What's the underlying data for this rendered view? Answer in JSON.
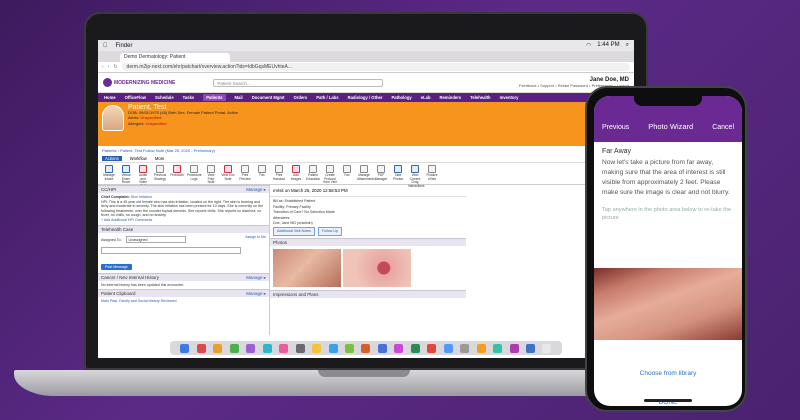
{
  "mac": {
    "app": "Finder",
    "clock": "1:44 PM"
  },
  "browser": {
    "tab": "Demo Dermatology: Patient",
    "url": "derm.m2ip-next.com/ehr/patchart/overview.action?ids=IdbGqsMEUvhteA..."
  },
  "app": {
    "logo": "MODERNIZING MEDICINE",
    "search_placeholder": "Patient Search...",
    "user_name": "Jane Doe, MD",
    "user_links": "Feedback • Support • Retain Password • Preferences • Logout",
    "nav": [
      "Home",
      "OfficeFlow",
      "Schedule",
      "Tasks",
      "Patients",
      "Mail",
      "Document Mgmt",
      "Orders",
      "Path / Labs",
      "Radiology / Other",
      "Pathology",
      "eLab",
      "Reminders",
      "Telehealth",
      "Inventory"
    ],
    "nav_active": "Patients"
  },
  "patient": {
    "name": "Patient, Test",
    "dob_line": "DOB: 09/01/1975 (45)   Birth Sex: Female   Patient Portal: Active",
    "alerts_label": "Alerts:",
    "alerts_value": "Unspecified",
    "allergies_label": "Allergies:",
    "allergies_value": "Unspecified",
    "buttons": [
      "Call Back",
      "",
      ""
    ],
    "breadcrumb": "Patients › Patient, Test Follow Note (Mar 25, 2020 - Preliminary)"
  },
  "tool_tabs": [
    "Actions",
    "Workflow",
    "More"
  ],
  "tools": [
    {
      "label": "Manage Intake",
      "tone": "b"
    },
    {
      "label": "Virtual Exam Room",
      "tone": "b"
    },
    {
      "label": "Audio and Video Call",
      "tone": "r"
    },
    {
      "label": "Previous Strategy",
      "tone": ""
    },
    {
      "label": "Protocols",
      "tone": "r"
    },
    {
      "label": "Procedure Logs",
      "tone": ""
    },
    {
      "label": "View Prior Note",
      "tone": ""
    },
    {
      "label": "View Enc Note",
      "tone": "r"
    },
    {
      "label": "Print Preview",
      "tone": ""
    },
    {
      "label": "Fax",
      "tone": ""
    },
    {
      "label": "Print Handout",
      "tone": ""
    },
    {
      "label": "Add Images",
      "tone": "r"
    },
    {
      "label": "Patient Education",
      "tone": ""
    },
    {
      "label": "Create Protocol from Visit",
      "tone": ""
    },
    {
      "label": "Fax",
      "tone": ""
    },
    {
      "label": "Manage Attachments",
      "tone": ""
    },
    {
      "label": "PDF Manager",
      "tone": ""
    },
    {
      "label": "Take Photos",
      "tone": "b"
    },
    {
      "label": "View Current Drug Interactions",
      "tone": "b"
    },
    {
      "label": "Finalize eVisit",
      "tone": ""
    }
  ],
  "left": {
    "cc_head": "CC/HPI",
    "manage": "Manage ▸",
    "chief_complaint_label": "Chief Complaint:",
    "chief_complaint_value": "Skin Irritation",
    "hpi": "HPI: This is a 45 year old female who has skin irritation, located on the right. The skin is burning and itchy and moderate in severity. The skin irritation has been present for 10 days. She is currently on the following treatments: over the counter topical steroids. She reports chills. She reports no diarrhea, no fever, no chills, no cough, and no anxiety.",
    "add_link": "+ Add Additional HPI Comments",
    "tele_head": "Telehealth Case",
    "assigned_label": "Assigned To:",
    "assigned_value": "Unassigned",
    "assign_me": "Assign to Me",
    "post_btn": "Post Message",
    "cancer_head": "Cancer / Neo Internal History",
    "cancer_text": "No internal history has been updated this encounter.",
    "clip_head": "Patient Clipboard",
    "clip_link": "Mark Past, Family and Social History Reviewed"
  },
  "mid": {
    "visit_head": "eVisit on March 25, 2020 12:58:53 PM",
    "lines": [
      "Bill as: Established Patient",
      "Facility: Primary Facility",
      "Transition of Care? No Selection Made",
      "Attendees:",
      "Doe, Jane MD (w/admin)"
    ],
    "btn1": "Additional Visit Notes",
    "btn2": "Follow Up",
    "photos_head": "Photos",
    "impressions_head": "Impressions and Plans"
  },
  "phone": {
    "back": "Previous",
    "title": "Photo Wizard",
    "cancel": "Cancel",
    "step_title": "Far Away",
    "step_text": "Now let's take a picture from far away, making sure that the area of interest is still visible from approximately 2 feet. Please make sure the image is clear and not blurry.",
    "tap_hint": "Tap anywhere in the photo area below to re-take the picture",
    "choose_library": "Choose from library",
    "done": "DONE"
  },
  "dock_colors": [
    "#3b7be0",
    "#d94b4b",
    "#e7a02f",
    "#4cb04c",
    "#9b5fd6",
    "#2fb6c9",
    "#e85d9b",
    "#6a6a6a",
    "#f0c53a",
    "#3aa0e8",
    "#7bc043",
    "#d65f2a",
    "#4a6fd6",
    "#c94ad6",
    "#2e8b57",
    "#e0463b",
    "#5599ff",
    "#9a9a9a",
    "#f59e1f",
    "#36c2a4",
    "#b03ab0",
    "#3f72c6",
    "#e8e8e8"
  ]
}
